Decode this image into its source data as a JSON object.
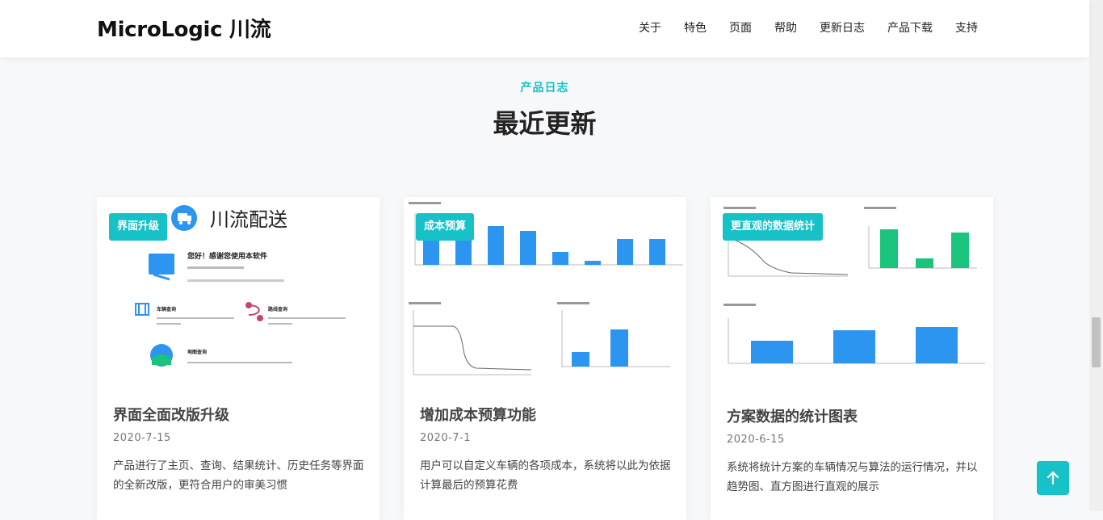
{
  "brand": "MicroLogic 川流",
  "nav": [
    "关于",
    "特色",
    "页面",
    "帮助",
    "更新日志",
    "产品下载",
    "支持"
  ],
  "section": {
    "tag": "产品日志",
    "title": "最近更新"
  },
  "cards": [
    {
      "badge": "界面升级",
      "title": "界面全面改版升级",
      "date": "2020-7-15",
      "text": "产品进行了主页、查询、结果统计、历史任务等界面的全新改版，更符合用户的审美习惯",
      "img": {
        "logo_text": "川流配送",
        "greeting": "您好！感谢您使用本软件",
        "items": [
          "车辆查询",
          "路线查询",
          "地图查询"
        ]
      }
    },
    {
      "badge": "成本预算",
      "title": "增加成本预算功能",
      "date": "2020-7-1",
      "text": "用户可以自定义车辆的各项成本，系统将以此为依据计算最后的预算花费"
    },
    {
      "badge": "更直观的数据统计",
      "title": "方案数据的统计图表",
      "date": "2020-6-15",
      "text": "系统将统计方案的车辆情况与算法的运行情况，并以趋势图、直方图进行直观的展示"
    }
  ],
  "colors": {
    "accent": "#17c1c8",
    "bar_blue": "#2b95f0",
    "bar_green": "#1bc47d"
  },
  "back_to_top_icon": "arrow-up-icon"
}
